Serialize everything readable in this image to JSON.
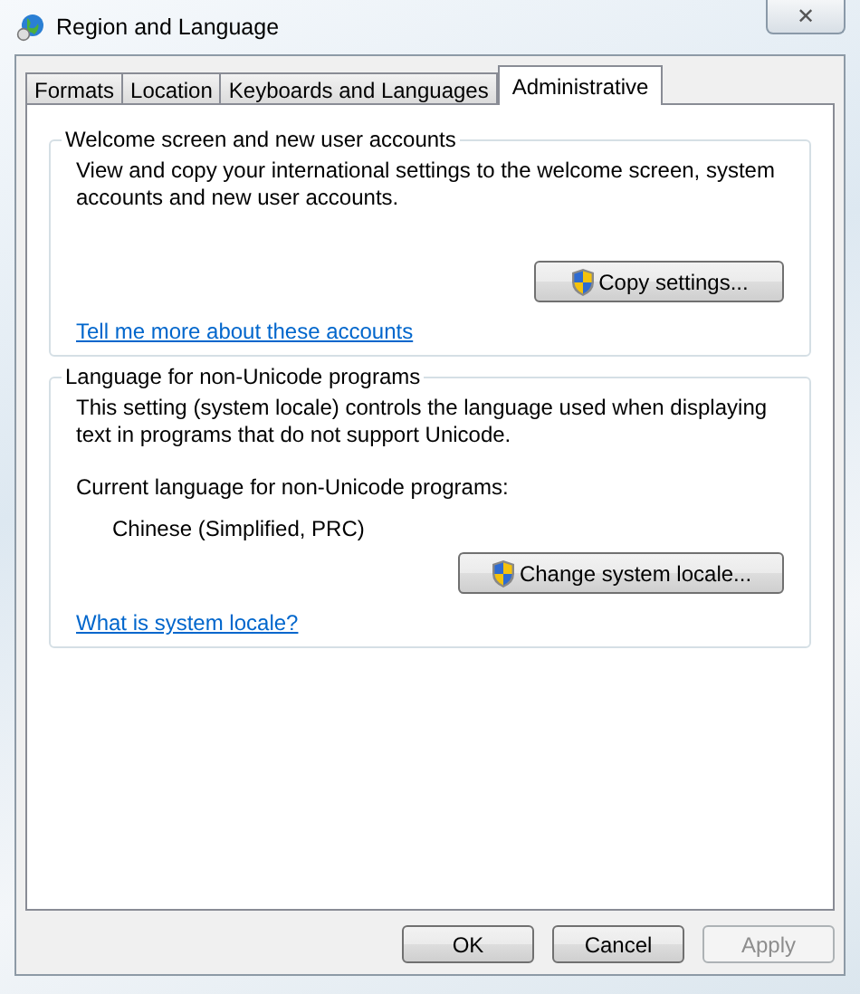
{
  "window": {
    "title": "Region and Language",
    "close": "✕"
  },
  "tabs": [
    {
      "label": "Formats",
      "selected": false
    },
    {
      "label": "Location",
      "selected": false
    },
    {
      "label": "Keyboards and Languages",
      "selected": false
    },
    {
      "label": "Administrative",
      "selected": true
    }
  ],
  "groups": [
    {
      "title": "Welcome screen and new user accounts",
      "description": "View and copy your international settings to the welcome screen, system accounts and new user accounts.",
      "button": "Copy settings...",
      "link": "Tell me more about these accounts"
    },
    {
      "title": "Language for non-Unicode programs",
      "description": "This setting (system locale) controls the language used when displaying text in programs that do not support Unicode.",
      "current_label": "Current language for non-Unicode programs:",
      "current_value": "Chinese (Simplified, PRC)",
      "button": "Change system locale...",
      "link": "What is system locale?"
    }
  ],
  "buttons": [
    {
      "label": "OK",
      "disabled": false
    },
    {
      "label": "Cancel",
      "disabled": false
    },
    {
      "label": "Apply",
      "disabled": true
    }
  ]
}
